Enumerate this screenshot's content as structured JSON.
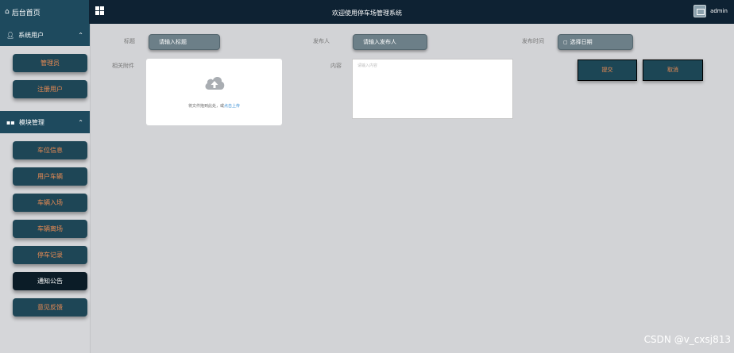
{
  "header": {
    "brand": "后台首页",
    "welcome": "欢迎使用停车场管理系统",
    "username": "admin"
  },
  "sidebar": {
    "groups": [
      {
        "title": "系统用户",
        "items": [
          {
            "label": "管理员"
          },
          {
            "label": "注册用户"
          }
        ]
      },
      {
        "title": "模块管理",
        "items": [
          {
            "label": "车位信息"
          },
          {
            "label": "用户车辆"
          },
          {
            "label": "车辆入场"
          },
          {
            "label": "车辆离场"
          },
          {
            "label": "停车记录"
          },
          {
            "label": "通知公告",
            "active": true
          },
          {
            "label": "意见反馈"
          }
        ]
      }
    ]
  },
  "form": {
    "title_label": "标题",
    "title_placeholder": "请输入标题",
    "publisher_label": "发布人",
    "publisher_placeholder": "请输入发布人",
    "time_label": "发布时间",
    "time_placeholder": "选择日期",
    "attachment_label": "相关附件",
    "upload_text": "将文件拖到此处，或",
    "upload_link": "点击上传",
    "content_label": "内容",
    "content_placeholder": "请输入内容",
    "submit_label": "提交",
    "cancel_label": "取消"
  },
  "watermark": "CSDN @v_cxsj813",
  "colors": {
    "topbar": "#0e2233",
    "sidebar_head": "#1e4a5e",
    "menu_button": "#1e4656",
    "menu_text": "#e98b53",
    "input_bg": "#6c7f88",
    "page_bg": "#d2d3d6"
  },
  "icons": {
    "brand": "home-icon",
    "menu_toggle": "grid-icon",
    "user_group": "user-icon",
    "module_group": "grid-icon",
    "upload": "cloud-upload-icon",
    "date": "calendar-icon",
    "collapse": "chevron-up-icon"
  }
}
